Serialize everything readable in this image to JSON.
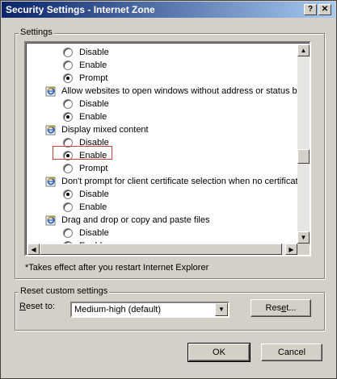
{
  "window": {
    "title": "Security Settings - Internet Zone",
    "help_glyph": "?",
    "close_glyph": "✕"
  },
  "settings_group": {
    "legend": "Settings",
    "rows": [
      {
        "kind": "radio",
        "label": "Disable",
        "checked": false
      },
      {
        "kind": "radio",
        "label": "Enable",
        "checked": false
      },
      {
        "kind": "radio",
        "label": "Prompt",
        "checked": true
      },
      {
        "kind": "heading",
        "label": "Allow websites to open windows without address or status ba",
        "icon": "ie-settings-icon"
      },
      {
        "kind": "radio",
        "label": "Disable",
        "checked": false
      },
      {
        "kind": "radio",
        "label": "Enable",
        "checked": true
      },
      {
        "kind": "heading",
        "label": "Display mixed content",
        "icon": "ie-settings-icon"
      },
      {
        "kind": "radio",
        "label": "Disable",
        "checked": false
      },
      {
        "kind": "radio",
        "label": "Enable",
        "checked": true,
        "highlighted": true
      },
      {
        "kind": "radio",
        "label": "Prompt",
        "checked": false
      },
      {
        "kind": "heading",
        "label": "Don't prompt for client certificate selection when no certificat",
        "icon": "ie-settings-icon"
      },
      {
        "kind": "radio",
        "label": "Disable",
        "checked": true
      },
      {
        "kind": "radio",
        "label": "Enable",
        "checked": false
      },
      {
        "kind": "heading",
        "label": "Drag and drop or copy and paste files",
        "icon": "ie-settings-icon"
      },
      {
        "kind": "radio",
        "label": "Disable",
        "checked": false
      },
      {
        "kind": "radio",
        "label": "Enable",
        "checked": true
      }
    ],
    "note": "*Takes effect after you restart Internet Explorer"
  },
  "reset_group": {
    "legend": "Reset custom settings",
    "reset_to_label_accel": "R",
    "reset_to_label_rest": "eset to:",
    "dropdown_value": "Medium-high (default)",
    "reset_button_accel": "Res",
    "reset_button_accel_u": "e",
    "reset_button_rest": "t..."
  },
  "buttons": {
    "ok": "OK",
    "cancel": "Cancel"
  },
  "colors": {
    "title_gradient_start": "#0a246a",
    "title_gradient_end": "#a6caf0",
    "highlight_border": "#d04040",
    "dialog_face": "#d4d0c8"
  }
}
